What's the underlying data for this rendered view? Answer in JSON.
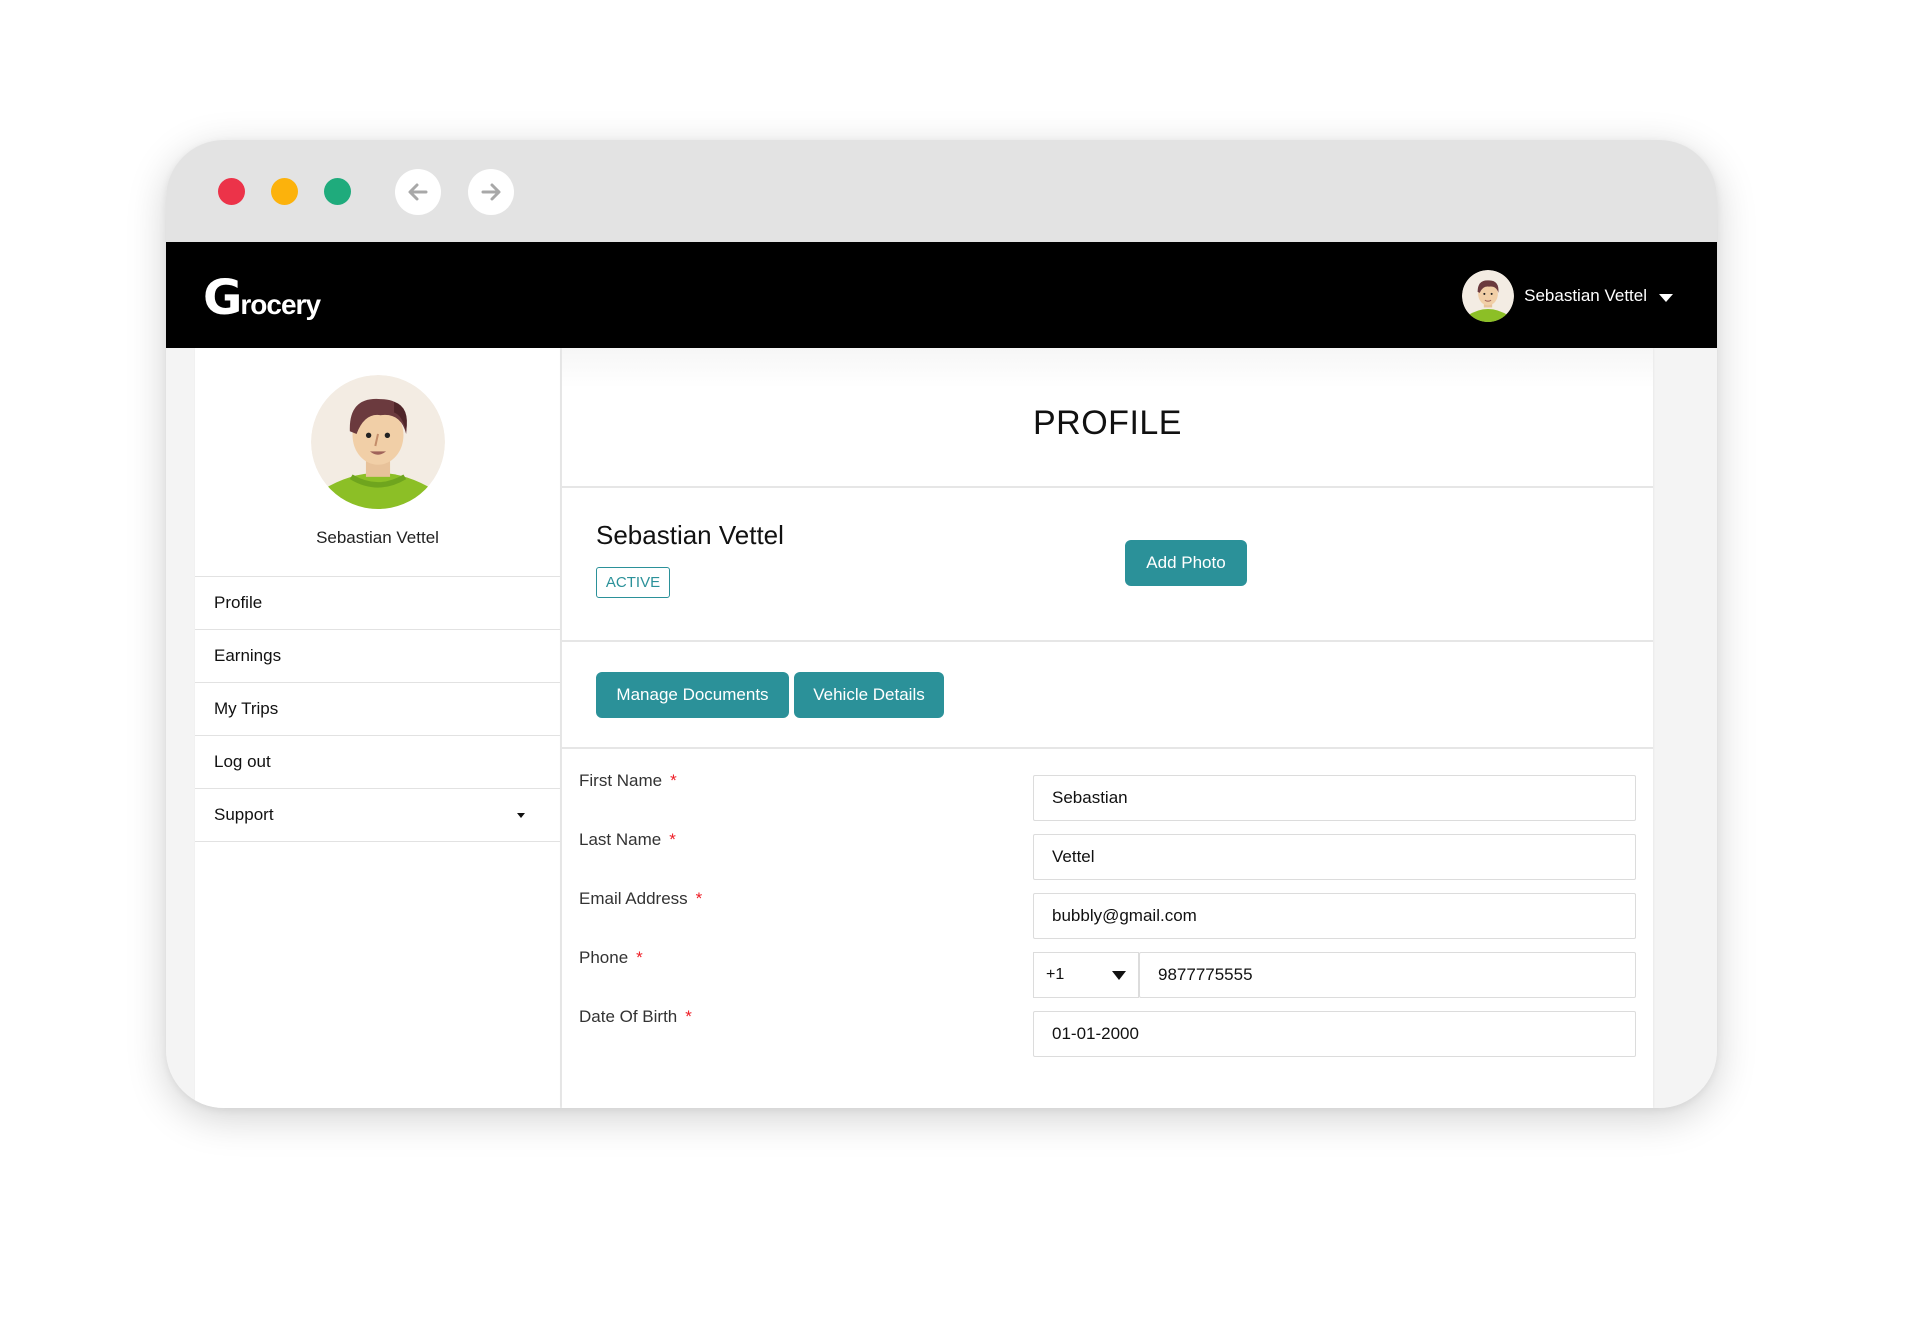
{
  "browser": {
    "traffic_lights": [
      {
        "name": "close",
        "color": "#ec3349"
      },
      {
        "name": "minimize",
        "color": "#fcb20c"
      },
      {
        "name": "maximize",
        "color": "#1fab7c"
      }
    ],
    "back_icon": "arrow-left-icon",
    "forward_icon": "arrow-right-icon"
  },
  "header": {
    "logo_initial": "G",
    "logo_rest": "rocery",
    "user_name": "Sebastian Vettel",
    "user_menu_icon": "caret-down-icon"
  },
  "sidebar": {
    "user_name": "Sebastian Vettel",
    "items": [
      {
        "label": "Profile"
      },
      {
        "label": "Earnings"
      },
      {
        "label": "My Trips"
      },
      {
        "label": "Log out"
      },
      {
        "label": "Support",
        "has_dropdown": true
      }
    ]
  },
  "main": {
    "title": "PROFILE",
    "profile_name": "Sebastian Vettel",
    "status_badge": "ACTIVE",
    "add_photo_label": "Add Photo",
    "manage_documents_label": "Manage Documents",
    "vehicle_details_label": "Vehicle Details",
    "form": {
      "first_name": {
        "label": "First Name",
        "required_mark": "*",
        "value": "Sebastian"
      },
      "last_name": {
        "label": "Last Name",
        "required_mark": "*",
        "value": "Vettel"
      },
      "email": {
        "label": "Email Address",
        "required_mark": "*",
        "value": "bubbly@gmail.com"
      },
      "phone": {
        "label": "Phone",
        "required_mark": "*",
        "country_code": "+1",
        "value": "9877775555"
      },
      "dob": {
        "label": "Date Of Birth",
        "required_mark": "*",
        "value": "01-01-2000"
      }
    }
  },
  "colors": {
    "accent": "#2b9199",
    "header_bg": "#000000",
    "chrome_bg": "#e3e3e3",
    "required": "#ee1c25"
  }
}
